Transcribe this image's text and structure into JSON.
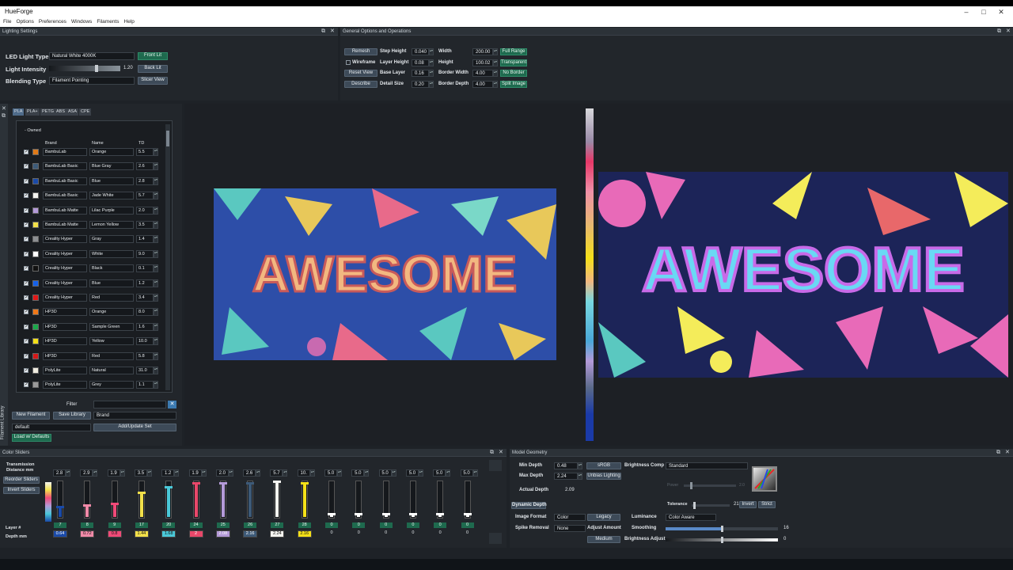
{
  "app": {
    "title": "HueForge"
  },
  "menu": [
    "File",
    "Options",
    "Preferences",
    "Windows",
    "Filaments",
    "Help"
  ],
  "lighting": {
    "header": "Lighting Settings",
    "led_label": "LED Light Type",
    "led_value": "Natural White 4000K",
    "front_lit": "Front Lit",
    "intensity_label": "Light Intensity",
    "intensity_value": "1.20",
    "back_lit": "Back Lit",
    "blending_label": "Blending Type",
    "blending_value": "Filament Pointing",
    "slicer_view": "Slicer View"
  },
  "general": {
    "header": "General Options and Operations",
    "remesh": "Remesh",
    "wireframe": "Wireframe",
    "reset_view": "Reset View",
    "describe": "Describe",
    "step_height_label": "Step Height",
    "step_height": "0.040",
    "layer_height_label": "Layer Height",
    "layer_height": "0.08",
    "base_layer_label": "Base Layer",
    "base_layer": "0.16",
    "detail_size_label": "Detail Size",
    "detail_size": "0.20",
    "width_label": "Width",
    "width": "200.00",
    "height_label": "Height",
    "height": "100.02",
    "border_width_label": "Border Width",
    "border_width": "4.00",
    "border_depth_label": "Border Depth",
    "border_depth": "4.00",
    "full_range": "Full Range",
    "transparent": "Transparent",
    "no_border": "No Border",
    "split_image": "Split Image"
  },
  "library": {
    "side_label": "Filament Library",
    "tabs": [
      "PLA",
      "PLA+",
      "PETG",
      "ABS",
      "ASA",
      "CPE"
    ],
    "owned": "- Owned",
    "col_brand": "Brand",
    "col_name": "Name",
    "col_td": "TD",
    "rows": [
      {
        "brand": "BambuLab",
        "name": "Orange",
        "td": "5.5",
        "color": "#e07a18"
      },
      {
        "brand": "BambuLab Basic",
        "name": "Blue Gray",
        "td": "2.6",
        "color": "#3d5a78"
      },
      {
        "brand": "BambuLab Basic",
        "name": "Blue",
        "td": "2.8",
        "color": "#1a4aa8"
      },
      {
        "brand": "BambuLab Basic",
        "name": "Jade White",
        "td": "5.7",
        "color": "#f4f4f0"
      },
      {
        "brand": "BambuLab Matte",
        "name": "Lilac Purple",
        "td": "2.0",
        "color": "#b49ad8"
      },
      {
        "brand": "BambuLab Matte",
        "name": "Lemon Yellow",
        "td": "3.5",
        "color": "#f2e04a"
      },
      {
        "brand": "Creality Hyper",
        "name": "Gray",
        "td": "1.4",
        "color": "#8d8f92"
      },
      {
        "brand": "Creality Hyper",
        "name": "White",
        "td": "9.0",
        "color": "#ffffff"
      },
      {
        "brand": "Creality Hyper",
        "name": "Black",
        "td": "0.1",
        "color": "#111111"
      },
      {
        "brand": "Creality Hyper",
        "name": "Blue",
        "td": "1.2",
        "color": "#1560e8"
      },
      {
        "brand": "Creality Hyper",
        "name": "Red",
        "td": "3.4",
        "color": "#e01818"
      },
      {
        "brand": "HP3D",
        "name": "Orange",
        "td": "8.0",
        "color": "#f07818"
      },
      {
        "brand": "HP3D",
        "name": "Sample Green",
        "td": "1.6",
        "color": "#1aa84a"
      },
      {
        "brand": "HP3D",
        "name": "Yellow",
        "td": "10.0",
        "color": "#f4e018"
      },
      {
        "brand": "HP3D",
        "name": "Red",
        "td": "5.8",
        "color": "#d41818"
      },
      {
        "brand": "PolyLite",
        "name": "Natural",
        "td": "31.0",
        "color": "#f0ece0"
      },
      {
        "brand": "PolyLite",
        "name": "Grey",
        "td": "1.1",
        "color": "#9a9a9a"
      }
    ],
    "filter_label": "Filter",
    "new_filament": "New Filament",
    "save_library": "Save Library",
    "brand_value": "Brand",
    "default_value": "default",
    "add_update": "Add/Update Set",
    "load_defaults": "Load w/ Defaults"
  },
  "preview": {
    "text": "AWESOME"
  },
  "color_sliders": {
    "header": "Color Sliders",
    "transmission_label": "Transmission Distance mm",
    "reorder": "Reorder Sliders",
    "invert": "Invert Sliders",
    "layer_label": "Layer #",
    "depth_label": "Depth mm",
    "sliders": [
      {
        "td": "2.8",
        "layer": "7",
        "depth": "0.64",
        "color": "#1a4aa8",
        "level": 0.3
      },
      {
        "td": "2.9",
        "layer": "8",
        "depth": "0.72",
        "color": "#f08aa8",
        "level": 0.35
      },
      {
        "td": "1.9",
        "layer": "9",
        "depth": "0.8",
        "color": "#f04a78",
        "level": 0.4
      },
      {
        "td": "3.5",
        "layer": "17",
        "depth": "1.44",
        "color": "#f2e04a",
        "level": 0.7
      },
      {
        "td": "1.2",
        "layer": "20",
        "depth": "1.68",
        "color": "#4ac8d8",
        "level": 0.85
      },
      {
        "td": "1.9",
        "layer": "24",
        "depth": "2",
        "color": "#e8486a",
        "level": 0.95
      },
      {
        "td": "2.0",
        "layer": "25",
        "depth": "2.08",
        "color": "#b49ad8",
        "level": 0.95
      },
      {
        "td": "2.6",
        "layer": "26",
        "depth": "2.16",
        "color": "#3d5a78",
        "level": 0.95
      },
      {
        "td": "5.7",
        "layer": "27",
        "depth": "2.24",
        "color": "#f4f4f0",
        "level": 1.0
      },
      {
        "td": "10.",
        "layer": "28",
        "depth": "2.16",
        "color": "#f4e018",
        "level": 0.95
      },
      {
        "td": "5.0",
        "layer": "0",
        "depth": "0",
        "color": "#ffffff",
        "level": 0.1
      },
      {
        "td": "5.0",
        "layer": "0",
        "depth": "0",
        "color": "#ffffff",
        "level": 0.1
      },
      {
        "td": "5.0",
        "layer": "0",
        "depth": "0",
        "color": "#ffffff",
        "level": 0.1
      },
      {
        "td": "5.0",
        "layer": "0",
        "depth": "0",
        "color": "#ffffff",
        "level": 0.1
      },
      {
        "td": "5.0",
        "layer": "0",
        "depth": "0",
        "color": "#ffffff",
        "level": 0.1
      },
      {
        "td": "5.0",
        "layer": "0",
        "depth": "0",
        "color": "#ffffff",
        "level": 0.1
      }
    ]
  },
  "model_geometry": {
    "header": "Model Geometry",
    "min_depth_label": "Min Depth",
    "min_depth": "0.48",
    "srgb": "sRGB",
    "max_depth_label": "Max Depth",
    "max_depth": "2.24",
    "unbias": "Unbias Lighting",
    "actual_depth_label": "Actual Depth",
    "actual_depth": "2.09",
    "brightness_comp_label": "Brightness Comp",
    "brightness_comp": "Standard",
    "power_label": "Power",
    "power_value": "2.0",
    "tolerance_label": "Tolerance",
    "tolerance": "21",
    "invert": "Invert",
    "strict": "Strict",
    "dynamic_depth": "Dynamic Depth",
    "image_format_label": "Image Format",
    "image_format": "Color",
    "legacy": "Legacy",
    "luminance_label": "Luminance",
    "luminance": "Color Aware",
    "spike_label": "Spike Removal",
    "spike": "None",
    "adjust_amount_label": "Adjust Amount",
    "smoothing_label": "Smoothing",
    "smoothing": "16",
    "medium": "Medium",
    "brightness_adjust_label": "Brightness Adjust",
    "brightness_adjust": "0"
  }
}
